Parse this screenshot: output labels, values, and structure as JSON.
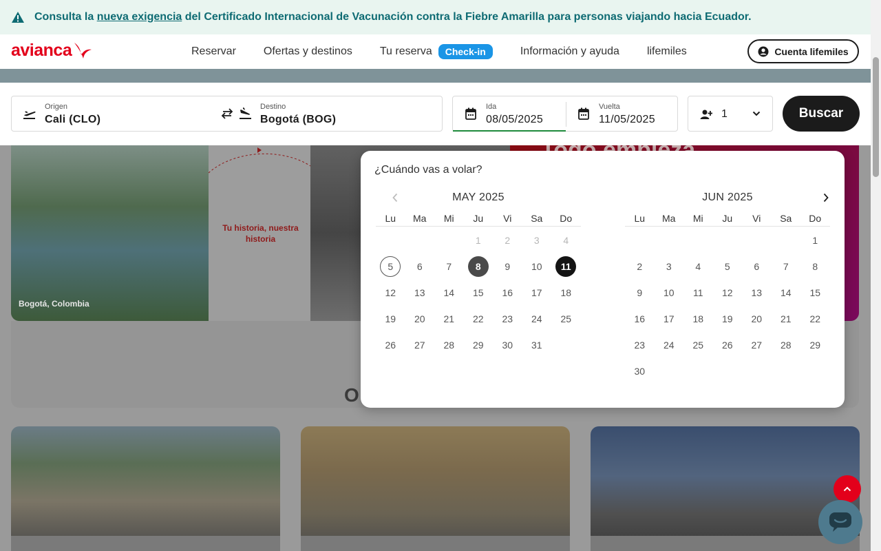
{
  "banner": {
    "text_before": "Consulta la ",
    "link": "nueva exigencia",
    "text_after": " del Certificado Internacional de Vacunación contra la Fiebre Amarilla para personas viajando hacia Ecuador."
  },
  "header": {
    "logo": "avianca",
    "nav": {
      "reservar": "Reservar",
      "ofertas": "Ofertas y destinos",
      "tu_reserva": "Tu reserva",
      "checkin": "Check-in",
      "informacion": "Información y ayuda",
      "lifemiles": "lifemiles"
    },
    "account": "Cuenta lifemiles"
  },
  "search": {
    "origin_label": "Origen",
    "origin_value": "Cali  (CLO)",
    "dest_label": "Destino",
    "dest_value": "Bogotá  (BOG)",
    "ida_label": "Ida",
    "ida_value": "08/05/2025",
    "vuelta_label": "Vuelta",
    "vuelta_value": "11/05/2025",
    "passengers": "1",
    "button": "Buscar"
  },
  "promo": {
    "location": "Bogotá, Colombia",
    "story": "Tu historia, nuestra historia",
    "headline": "Todo empieza"
  },
  "section_letter": "O",
  "calendar": {
    "question": "¿Cuándo vas a volar?",
    "weekdays": [
      "Lu",
      "Ma",
      "Mi",
      "Ju",
      "Vi",
      "Sa",
      "Do"
    ],
    "months": [
      {
        "title": "MAY 2025",
        "offset": 3,
        "days": [
          "1",
          "2",
          "3",
          "4",
          "5",
          "6",
          "7",
          "8",
          "9",
          "10",
          "11",
          "12",
          "13",
          "14",
          "15",
          "16",
          "17",
          "18",
          "19",
          "20",
          "21",
          "22",
          "23",
          "24",
          "25",
          "26",
          "27",
          "28",
          "29",
          "30",
          "31"
        ],
        "disabled_until": 4,
        "today": 5,
        "selected_start": 8,
        "selected_end": 11
      },
      {
        "title": "JUN 2025",
        "offset": 6,
        "days": [
          "1",
          "2",
          "3",
          "4",
          "5",
          "6",
          "7",
          "8",
          "9",
          "10",
          "11",
          "12",
          "13",
          "14",
          "15",
          "16",
          "17",
          "18",
          "19",
          "20",
          "21",
          "22",
          "23",
          "24",
          "25",
          "26",
          "27",
          "28",
          "29",
          "30"
        ],
        "disabled_until": 0,
        "today": 0,
        "selected_start": 0,
        "selected_end": 0
      }
    ]
  },
  "colors": {
    "brand_red": "#e3001b",
    "checkin_blue": "#1a95e6",
    "banner_text": "#0e6b73",
    "active_underline": "#1e8a3c"
  }
}
